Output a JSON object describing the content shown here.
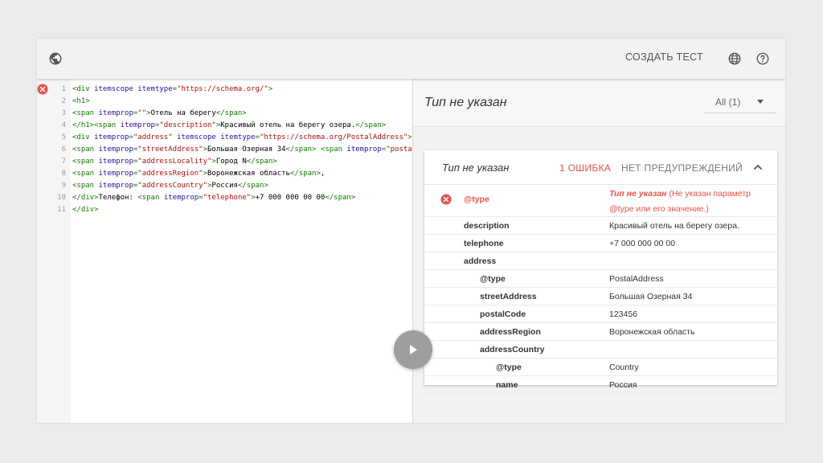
{
  "toolbar": {
    "create_test_label": "СОЗДАТЬ ТЕСТ"
  },
  "editor": {
    "line_numbers": [
      "1",
      "2",
      "3",
      "4",
      "5",
      "6",
      "7",
      "8",
      "9",
      "10",
      "11"
    ],
    "lines": [
      [
        [
          "tag",
          "<div "
        ],
        [
          "attr",
          "itemscope itemtype"
        ],
        [
          "tag",
          "="
        ],
        [
          "str",
          "\"https://schema.org/\""
        ],
        [
          "tag",
          ">"
        ]
      ],
      [
        [
          "tag",
          "<h1>"
        ]
      ],
      [
        [
          "tag",
          "<span "
        ],
        [
          "attr",
          "itemprop"
        ],
        [
          "tag",
          "="
        ],
        [
          "str",
          "\"\""
        ],
        [
          "tag",
          ">"
        ],
        [
          "txt",
          "Отель на берегу"
        ],
        [
          "tag",
          "</span>"
        ]
      ],
      [
        [
          "tag",
          "</h1><span "
        ],
        [
          "attr",
          "itemprop"
        ],
        [
          "tag",
          "="
        ],
        [
          "str",
          "\"description\""
        ],
        [
          "tag",
          ">"
        ],
        [
          "txt",
          "Красивый отель на берегу озера."
        ],
        [
          "tag",
          "</span>"
        ]
      ],
      [
        [
          "tag",
          "<div "
        ],
        [
          "attr",
          "itemprop"
        ],
        [
          "tag",
          "="
        ],
        [
          "str",
          "\"address\""
        ],
        [
          "tag",
          " "
        ],
        [
          "attr",
          "itemscope itemtype"
        ],
        [
          "tag",
          "="
        ],
        [
          "str",
          "\"https://schema.org/PostalAddress\""
        ],
        [
          "tag",
          ">"
        ]
      ],
      [
        [
          "tag",
          "<span "
        ],
        [
          "attr",
          "itemprop"
        ],
        [
          "tag",
          "="
        ],
        [
          "str",
          "\"streetAddress\""
        ],
        [
          "tag",
          ">"
        ],
        [
          "txt",
          "Большая Озерная 34"
        ],
        [
          "tag",
          "</span> <span "
        ],
        [
          "attr",
          "itemprop"
        ],
        [
          "tag",
          "="
        ],
        [
          "str",
          "\"postalCode\""
        ]
      ],
      [
        [
          "tag",
          "<span "
        ],
        [
          "attr",
          "itemprop"
        ],
        [
          "tag",
          "="
        ],
        [
          "str",
          "\"addressLocality\""
        ],
        [
          "tag",
          ">"
        ],
        [
          "txt",
          "Город N"
        ],
        [
          "tag",
          "</span>"
        ]
      ],
      [
        [
          "tag",
          "<span "
        ],
        [
          "attr",
          "itemprop"
        ],
        [
          "tag",
          "="
        ],
        [
          "str",
          "\"addressRegion\""
        ],
        [
          "tag",
          ">"
        ],
        [
          "txt",
          "Воронежская область"
        ],
        [
          "tag",
          "</span>"
        ],
        [
          "txt",
          ","
        ]
      ],
      [
        [
          "tag",
          "<span "
        ],
        [
          "attr",
          "itemprop"
        ],
        [
          "tag",
          "="
        ],
        [
          "str",
          "\"addressCountry\""
        ],
        [
          "tag",
          ">"
        ],
        [
          "txt",
          "Россия"
        ],
        [
          "tag",
          "</span>"
        ]
      ],
      [
        [
          "tag",
          "</div>"
        ],
        [
          "txt",
          "Телефон: "
        ],
        [
          "tag",
          "<span "
        ],
        [
          "attr",
          "itemprop"
        ],
        [
          "tag",
          "="
        ],
        [
          "str",
          "\"telephone\""
        ],
        [
          "tag",
          ">"
        ],
        [
          "txt",
          "+7 000 000 00 00"
        ],
        [
          "tag",
          "</span>"
        ]
      ],
      [
        [
          "tag",
          "</div>"
        ]
      ]
    ]
  },
  "results": {
    "title": "Тип не указан",
    "filter_value": "All (1)"
  },
  "card": {
    "title": "Тип не указан",
    "errors_label": "1 ОШИБКА",
    "warnings_label": "НЕТ ПРЕДУПРЕЖДЕНИЙ",
    "error_row": {
      "key": "@type",
      "message_em": "Тип не указан",
      "message_rest": " (Не указан параметр @type или его значение.)"
    },
    "rows": [
      {
        "level": 0,
        "key": "description",
        "value": "Красивый отель на берегу озера."
      },
      {
        "level": 0,
        "key": "telephone",
        "value": "+7 000 000 00 00"
      },
      {
        "level": 0,
        "key": "address",
        "value": ""
      },
      {
        "level": 1,
        "key": "@type",
        "value": "PostalAddress"
      },
      {
        "level": 1,
        "key": "streetAddress",
        "value": "Большая Озерная 34"
      },
      {
        "level": 1,
        "key": "postalCode",
        "value": "123456"
      },
      {
        "level": 1,
        "key": "addressRegion",
        "value": "Воронежская область"
      },
      {
        "level": 1,
        "key": "addressCountry",
        "value": ""
      },
      {
        "level": 2,
        "key": "@type",
        "value": "Country"
      },
      {
        "level": 2,
        "key": "name",
        "value": "Россия"
      }
    ]
  },
  "colors": {
    "error": "#e5534b",
    "tag": "#117700",
    "attr": "#221199",
    "string": "#aa1111",
    "run_button": "#9e9e9e"
  },
  "icons": {
    "toolbar_left": "globe-icon",
    "toolbar_lang": "globe-icon",
    "toolbar_help": "help-icon",
    "gutter_error": "error-circle-icon",
    "card_collapse": "chevron-up-icon",
    "run": "play-icon"
  }
}
